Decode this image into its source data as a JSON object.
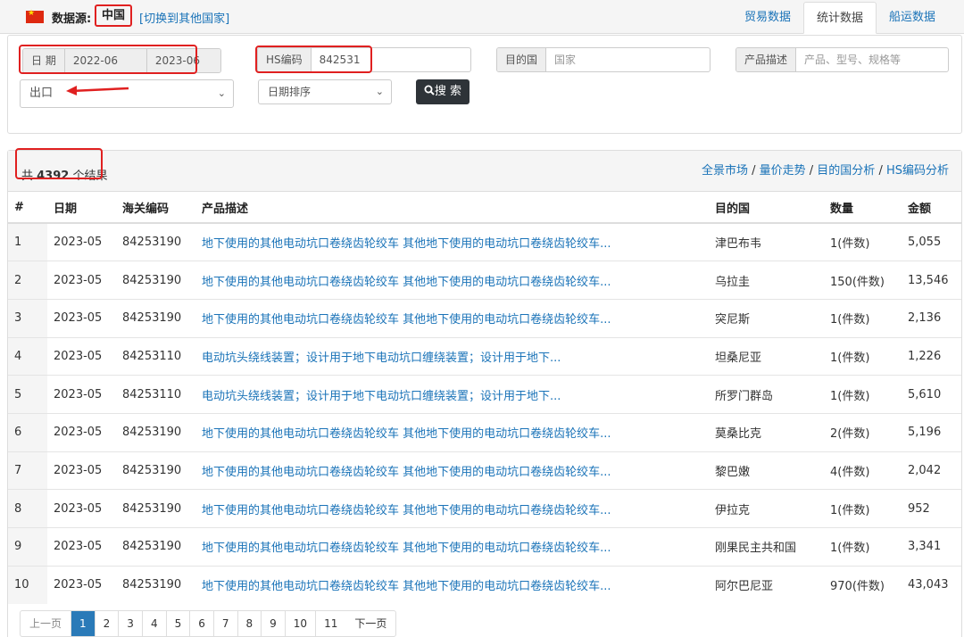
{
  "header": {
    "source_label": "数据源:",
    "country": "中国",
    "switch_link": "[切换到其他国家]",
    "tabs": [
      "贸易数据",
      "统计数据",
      "船运数据"
    ],
    "active_tab": "统计数据"
  },
  "filter": {
    "date_label": "日 期",
    "date_from": "2022-06",
    "date_to": "2023-06",
    "hs_label": "HS编码",
    "hs_value": "842531",
    "dest_label": "目的国",
    "dest_placeholder": "国家",
    "desc_label": "产品描述",
    "desc_placeholder": "产品、型号、规格等",
    "direction": "出口",
    "sort": "日期排序",
    "search_button": "搜 索"
  },
  "results": {
    "count_prefix": "共 ",
    "count": "4392",
    "count_suffix": " 个结果",
    "links": [
      "全景市场",
      "量价走势",
      "目的国分析",
      "HS编码分析"
    ],
    "columns": [
      "#",
      "日期",
      "海关编码",
      "产品描述",
      "目的国",
      "数量",
      "金额"
    ],
    "rows": [
      [
        "1",
        "2023-05",
        "84253190",
        "地下使用的其他电动坑口卷绕齿轮绞车 其他地下使用的电动坑口卷绕齿轮绞车...",
        "津巴布韦",
        "1(件数)",
        "5,055"
      ],
      [
        "2",
        "2023-05",
        "84253190",
        "地下使用的其他电动坑口卷绕齿轮绞车 其他地下使用的电动坑口卷绕齿轮绞车...",
        "乌拉圭",
        "150(件数)",
        "13,546"
      ],
      [
        "3",
        "2023-05",
        "84253190",
        "地下使用的其他电动坑口卷绕齿轮绞车 其他地下使用的电动坑口卷绕齿轮绞车...",
        "突尼斯",
        "1(件数)",
        "2,136"
      ],
      [
        "4",
        "2023-05",
        "84253110",
        "电动坑头绕线装置；设计用于地下电动坑口缠绕装置；设计用于地下...",
        "坦桑尼亚",
        "1(件数)",
        "1,226"
      ],
      [
        "5",
        "2023-05",
        "84253110",
        "电动坑头绕线装置；设计用于地下电动坑口缠绕装置；设计用于地下...",
        "所罗门群岛",
        "1(件数)",
        "5,610"
      ],
      [
        "6",
        "2023-05",
        "84253190",
        "地下使用的其他电动坑口卷绕齿轮绞车 其他地下使用的电动坑口卷绕齿轮绞车...",
        "莫桑比克",
        "2(件数)",
        "5,196"
      ],
      [
        "7",
        "2023-05",
        "84253190",
        "地下使用的其他电动坑口卷绕齿轮绞车 其他地下使用的电动坑口卷绕齿轮绞车...",
        "黎巴嫩",
        "4(件数)",
        "2,042"
      ],
      [
        "8",
        "2023-05",
        "84253190",
        "地下使用的其他电动坑口卷绕齿轮绞车 其他地下使用的电动坑口卷绕齿轮绞车...",
        "伊拉克",
        "1(件数)",
        "952"
      ],
      [
        "9",
        "2023-05",
        "84253190",
        "地下使用的其他电动坑口卷绕齿轮绞车 其他地下使用的电动坑口卷绕齿轮绞车...",
        "刚果民主共和国",
        "1(件数)",
        "3,341"
      ],
      [
        "10",
        "2023-05",
        "84253190",
        "地下使用的其他电动坑口卷绕齿轮绞车 其他地下使用的电动坑口卷绕齿轮绞车...",
        "阿尔巴尼亚",
        "970(件数)",
        "43,043"
      ]
    ]
  },
  "pagination": {
    "prev": "上一页",
    "pages": [
      "1",
      "2",
      "3",
      "4",
      "5",
      "6",
      "7",
      "8",
      "9",
      "10",
      "11"
    ],
    "current": "1",
    "next": "下一页"
  },
  "colors": {
    "link": "#1a73b8",
    "highlight_box": "#e02020",
    "flag_red": "#de2910",
    "button_dark": "#2e3338",
    "page_active": "#2a7ab8"
  }
}
